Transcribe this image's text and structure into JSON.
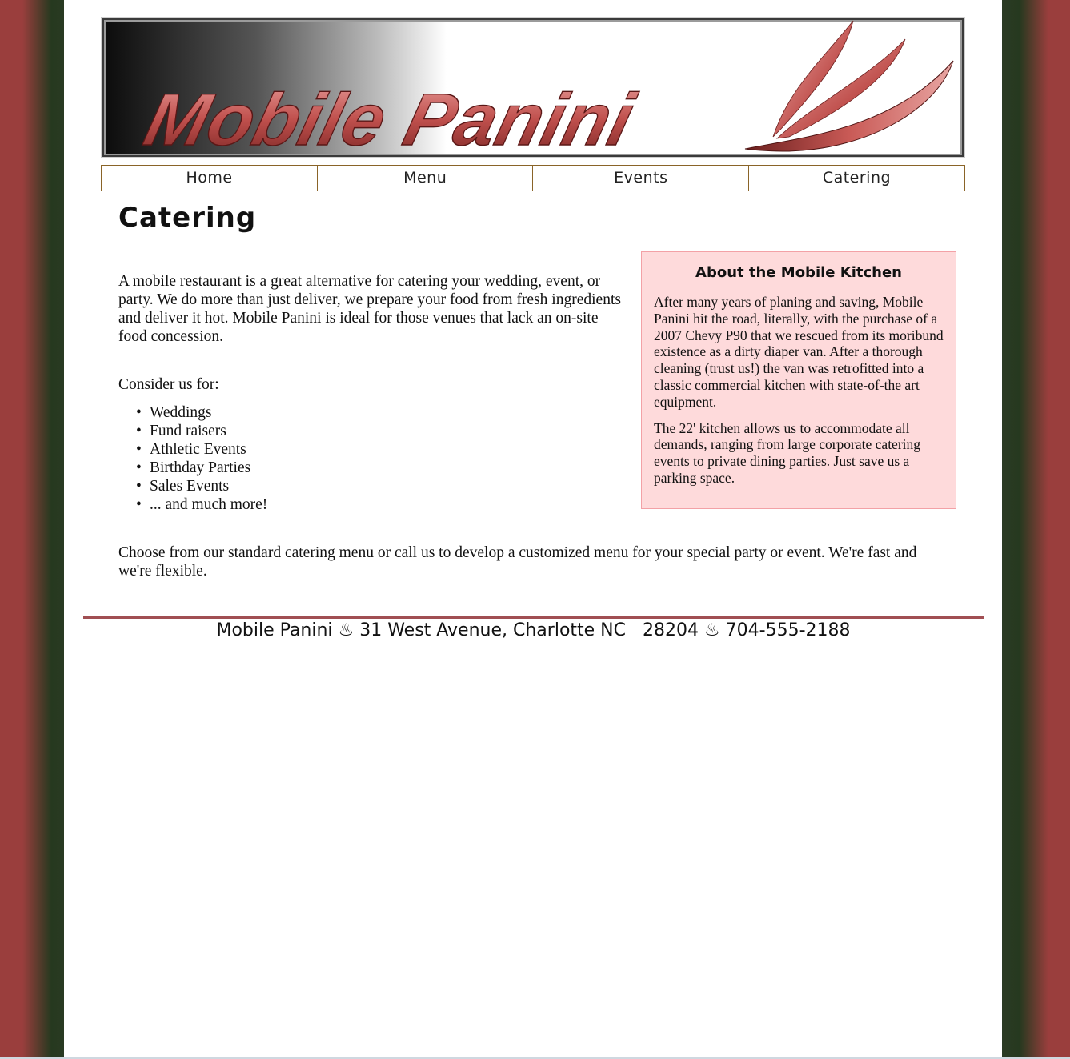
{
  "site": {
    "logo_text": "Mobile Panini",
    "colors": {
      "background": "#9a3e3d",
      "side_shadow": "#2b3a24",
      "logo_red": "#c0504d",
      "nav_border": "#8a6428",
      "aside_background": "#fedadb",
      "aside_border": "#f3a1a6",
      "footer_rule": "#a14f53"
    }
  },
  "nav": {
    "items": [
      {
        "label": "Home"
      },
      {
        "label": "Menu"
      },
      {
        "label": "Events"
      },
      {
        "label": "Catering"
      }
    ]
  },
  "main": {
    "title": "Catering",
    "intro": "A mobile restaurant is a great alternative for catering your wedding, event, or party. We do more than just deliver, we prepare your food from fresh ingredients and deliver it hot. Mobile Panini is ideal for those venues that lack an on-site food concession.",
    "consider_label": "Consider us for:",
    "uses": [
      "Weddings",
      "Fund raisers",
      "Athletic Events",
      "Birthday Parties",
      "Sales Events",
      "... and much more!"
    ],
    "closing": "Choose from our standard catering menu or call us to develop a customized menu for your special party or event. We're fast and we're flexible."
  },
  "aside": {
    "title": "About the Mobile Kitchen",
    "paragraphs": [
      "After many years of planing and saving, Mobile Panini hit the road, literally, with the purchase of a 2007 Chevy P90 that we rescued from its moribund existence as a dirty diaper van. After a thorough cleaning (trust us!) the van was retrofitted into a classic commercial kitchen with state-of-the art equipment.",
      "The 22' kitchen allows us to accommodate all demands, ranging from large corporate catering events to private dining parties. Just save us a parking space."
    ]
  },
  "footer": {
    "text": "Mobile Panini ♨ 31 West Avenue, Charlotte NC   28204 ♨ 704-555-2188"
  }
}
